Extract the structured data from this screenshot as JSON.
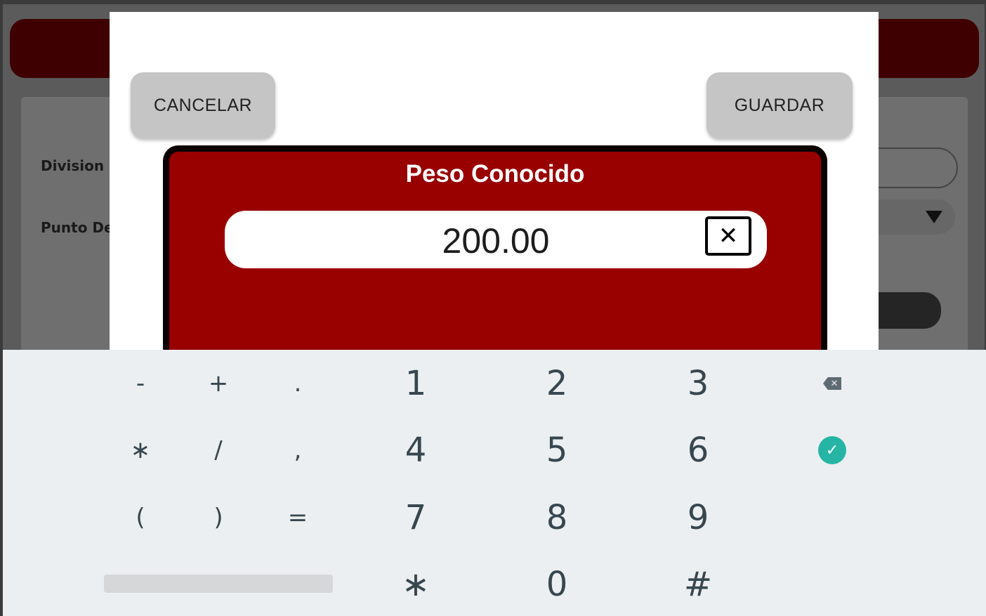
{
  "background": {
    "labels": [
      "Division m",
      "Punto Dec"
    ]
  },
  "dialog": {
    "cancel_label": "CANCELAR",
    "save_label": "GUARDAR",
    "panel_title": "Peso Conocido",
    "value": "200.00",
    "clear_icon": "close-box-icon"
  },
  "keyboard": {
    "rows": [
      [
        "-",
        "+",
        ".",
        "1",
        "2",
        "3",
        "backspace"
      ],
      [
        "∗",
        "/",
        ",",
        "4",
        "5",
        "6",
        "enter"
      ],
      [
        "(",
        ")",
        "=",
        "7",
        "8",
        "9"
      ],
      [
        "space",
        "∗",
        "0",
        "#"
      ]
    ],
    "backspace_icon": "backspace-icon",
    "enter_icon": "check-circle-icon"
  },
  "colors": {
    "panel": "#990000",
    "header_dimmed": "#3e0000",
    "keyboard_bg": "#eceff1",
    "key_text": "#37474f",
    "enter_accent": "#26b5a5"
  }
}
